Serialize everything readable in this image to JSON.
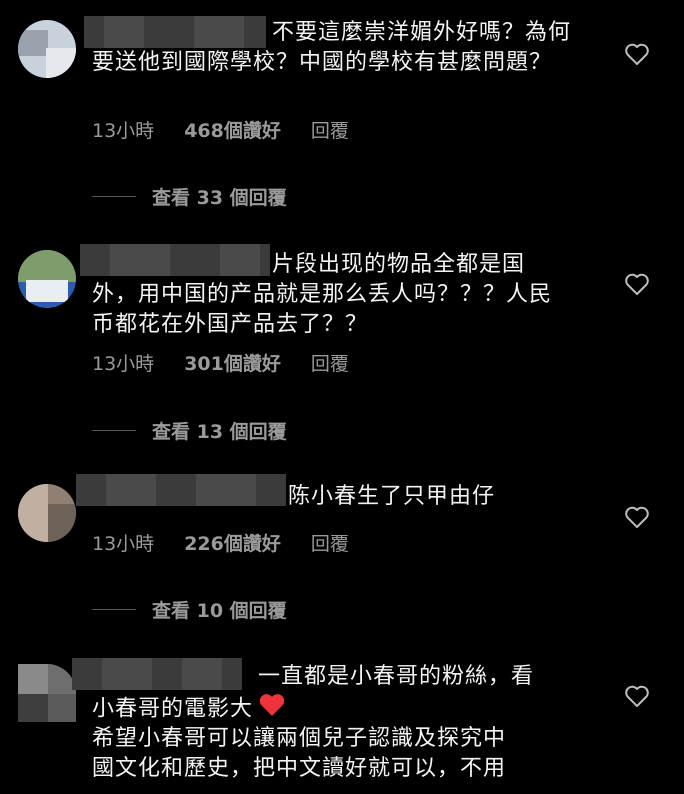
{
  "comments": [
    {
      "text": "不要這麼崇洋媚外好嗎？為何要送他到國際學校？中國的學校有甚麼問題？",
      "time": "13小時",
      "likes": "468個讚好",
      "reply": "回覆",
      "view_replies": "查看 33 個回覆"
    },
    {
      "text": "片段出现的物品全都是国外，用中国的产品就是那么丢人吗？？？人民币都花在外国产品去了？？",
      "time": "13小時",
      "likes": "301個讚好",
      "reply": "回覆",
      "view_replies": "查看 13 個回覆"
    },
    {
      "text": "陈小春生了只甲由仔",
      "time": "13小時",
      "likes": "226個讚好",
      "reply": "回覆",
      "view_replies": "查看 10 個回覆"
    },
    {
      "text_line1": "一直都是小春哥的粉絲，看",
      "text_line2": "小春哥的電影大",
      "text_line3": "希望小春哥可以讓兩個兒子認識及探究中",
      "text_line4": "國文化和歷史，把中文讀好就可以，不用"
    }
  ],
  "icons": {
    "like": "heart-outline-icon",
    "emoji": "red-heart-emoji"
  }
}
